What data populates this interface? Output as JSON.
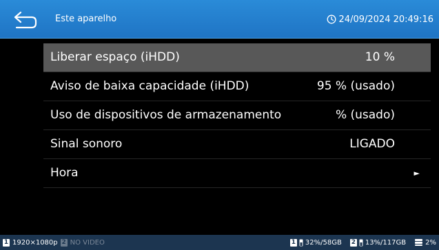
{
  "header": {
    "title": "Este aparelho",
    "datetime": "24/09/2024 20:49:16"
  },
  "menu": {
    "items": [
      {
        "label": "Liberar espaço (iHDD)",
        "value": "10 %"
      },
      {
        "label": "Aviso de baixa capacidade (iHDD)",
        "value": "95 % (usado)"
      },
      {
        "label": "Uso de dispositivos de armazenamento",
        "value": "% (usado)"
      },
      {
        "label": "Sinal sonoro",
        "value": "LIGADO"
      },
      {
        "label": "Hora",
        "value": "",
        "arrow": "►"
      }
    ]
  },
  "status": {
    "channel1_num": "1",
    "channel1_res": "1920×1080p",
    "channel2_num": "2",
    "channel2_text": "NO VIDEO",
    "drive1_num": "1",
    "drive1_usage": "32%/58GB",
    "drive2_num": "2",
    "drive2_usage": "13%/117GB",
    "db_label": "2%"
  }
}
